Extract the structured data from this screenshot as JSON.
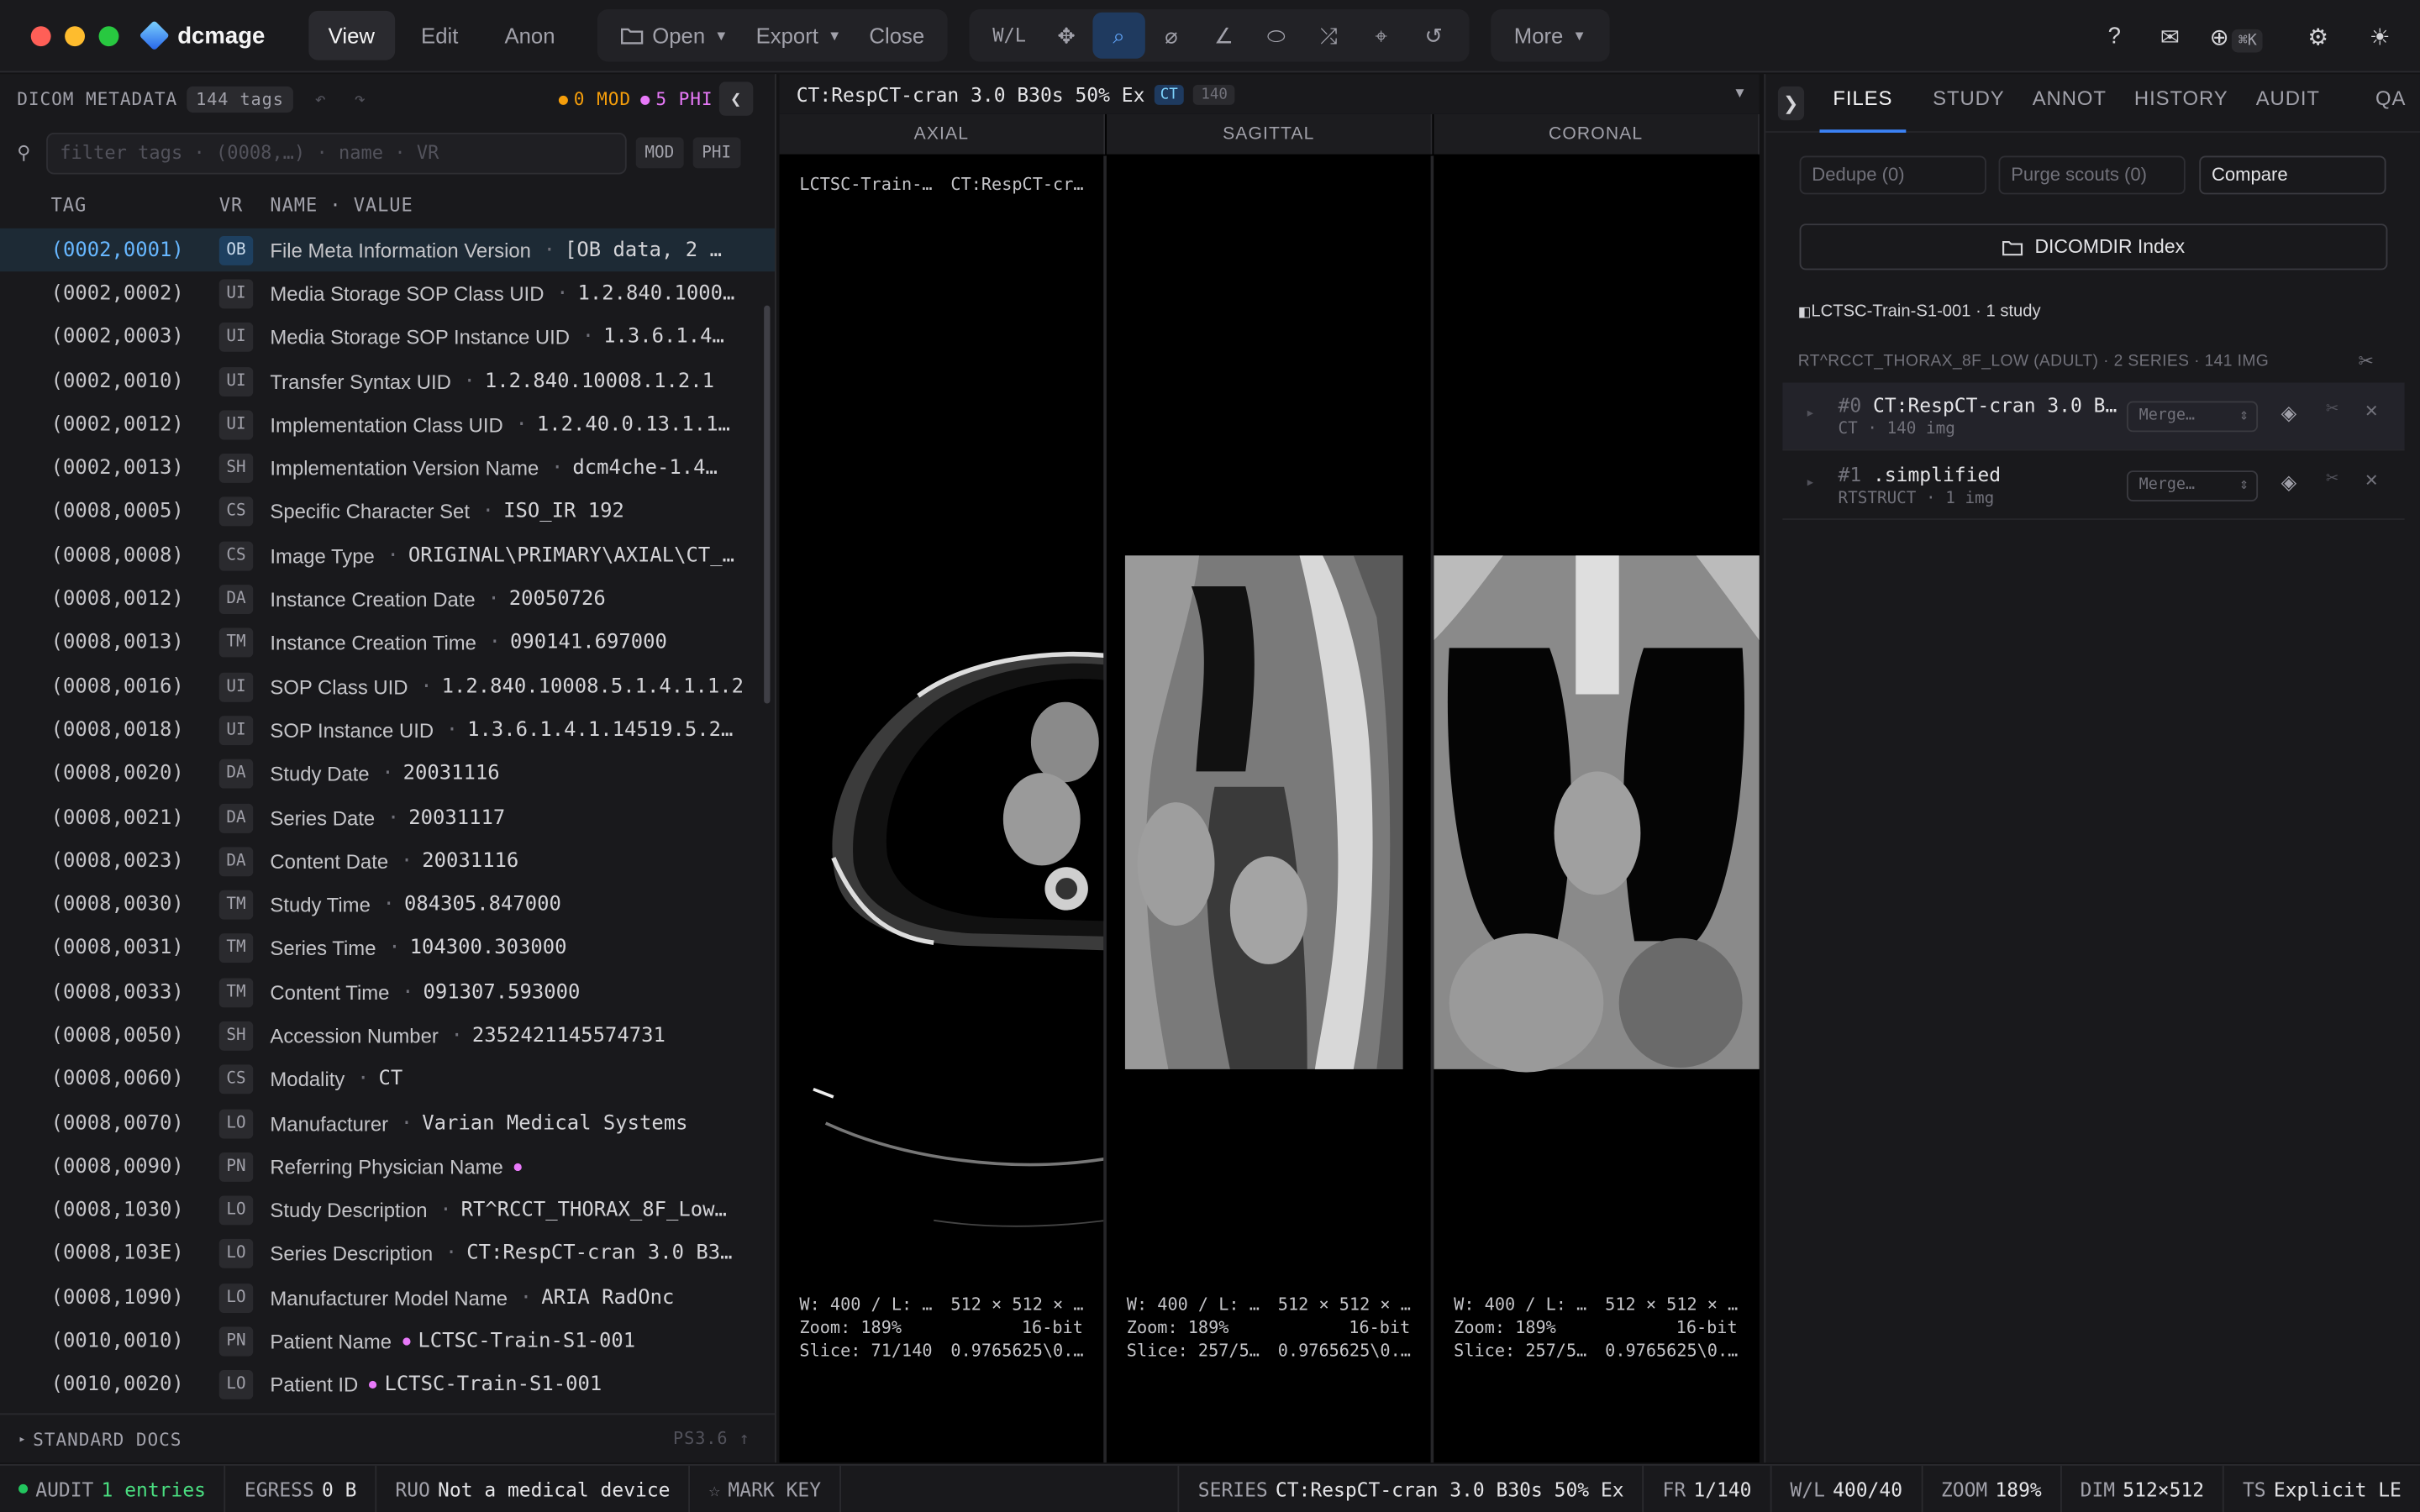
{
  "app": {
    "name": "dcmage"
  },
  "nav": {
    "tabs": [
      "View",
      "Edit",
      "Anon"
    ]
  },
  "file_menu": {
    "open": "Open",
    "export": "Export",
    "close": "Close"
  },
  "tools": {
    "wl": "W/L",
    "more": "More"
  },
  "right_icons": {
    "kbd": "⌘K"
  },
  "metadata": {
    "title": "DICOM METADATA",
    "count": "144 tags",
    "mod": "0 MOD",
    "phi": "5 PHI",
    "filter_placeholder": "filter tags · (0008,…) · name · VR",
    "mod_btn": "MOD",
    "phi_btn": "PHI",
    "col_tag": "TAG",
    "col_vr": "VR",
    "col_name": "NAME · VALUE",
    "rows": [
      {
        "tag": "(0002,0001)",
        "vr": "OB",
        "name": "File Meta Information Version",
        "value": "[OB data, 2 …"
      },
      {
        "tag": "(0002,0002)",
        "vr": "UI",
        "name": "Media Storage SOP Class UID",
        "value": "1.2.840.1000…"
      },
      {
        "tag": "(0002,0003)",
        "vr": "UI",
        "name": "Media Storage SOP Instance UID",
        "value": "1.3.6.1.4…"
      },
      {
        "tag": "(0002,0010)",
        "vr": "UI",
        "name": "Transfer Syntax UID",
        "value": "1.2.840.10008.1.2.1"
      },
      {
        "tag": "(0002,0012)",
        "vr": "UI",
        "name": "Implementation Class UID",
        "value": "1.2.40.0.13.1.1…"
      },
      {
        "tag": "(0002,0013)",
        "vr": "SH",
        "name": "Implementation Version Name",
        "value": "dcm4che-1.4…"
      },
      {
        "tag": "(0008,0005)",
        "vr": "CS",
        "name": "Specific Character Set",
        "value": "ISO_IR 192"
      },
      {
        "tag": "(0008,0008)",
        "vr": "CS",
        "name": "Image Type",
        "value": "ORIGINAL\\PRIMARY\\AXIAL\\CT_…"
      },
      {
        "tag": "(0008,0012)",
        "vr": "DA",
        "name": "Instance Creation Date",
        "value": "20050726"
      },
      {
        "tag": "(0008,0013)",
        "vr": "TM",
        "name": "Instance Creation Time",
        "value": "090141.697000"
      },
      {
        "tag": "(0008,0016)",
        "vr": "UI",
        "name": "SOP Class UID",
        "value": "1.2.840.10008.5.1.4.1.1.2"
      },
      {
        "tag": "(0008,0018)",
        "vr": "UI",
        "name": "SOP Instance UID",
        "value": "1.3.6.1.4.1.14519.5.2…"
      },
      {
        "tag": "(0008,0020)",
        "vr": "DA",
        "name": "Study Date",
        "value": "20031116"
      },
      {
        "tag": "(0008,0021)",
        "vr": "DA",
        "name": "Series Date",
        "value": "20031117"
      },
      {
        "tag": "(0008,0023)",
        "vr": "DA",
        "name": "Content Date",
        "value": "20031116"
      },
      {
        "tag": "(0008,0030)",
        "vr": "TM",
        "name": "Study Time",
        "value": "084305.847000"
      },
      {
        "tag": "(0008,0031)",
        "vr": "TM",
        "name": "Series Time",
        "value": "104300.303000"
      },
      {
        "tag": "(0008,0033)",
        "vr": "TM",
        "name": "Content Time",
        "value": "091307.593000"
      },
      {
        "tag": "(0008,0050)",
        "vr": "SH",
        "name": "Accession Number",
        "value": "2352421145574731"
      },
      {
        "tag": "(0008,0060)",
        "vr": "CS",
        "name": "Modality",
        "value": "CT"
      },
      {
        "tag": "(0008,0070)",
        "vr": "LO",
        "name": "Manufacturer",
        "value": "Varian Medical Systems"
      },
      {
        "tag": "(0008,0090)",
        "vr": "PN",
        "name": "Referring Physician Name",
        "value": "",
        "phi": true
      },
      {
        "tag": "(0008,1030)",
        "vr": "LO",
        "name": "Study Description",
        "value": "RT^RCCT_THORAX_8F_Low…"
      },
      {
        "tag": "(0008,103E)",
        "vr": "LO",
        "name": "Series Description",
        "value": "CT:RespCT-cran 3.0 B3…"
      },
      {
        "tag": "(0008,1090)",
        "vr": "LO",
        "name": "Manufacturer Model Name",
        "value": "ARIA RadOnc"
      },
      {
        "tag": "(0010,0010)",
        "vr": "PN",
        "name": "Patient Name",
        "value": "LCTSC-Train-S1-001",
        "phi": true
      },
      {
        "tag": "(0010,0020)",
        "vr": "LO",
        "name": "Patient ID",
        "value": "LCTSC-Train-S1-001",
        "phi": true
      }
    ],
    "standard_docs": "STANDARD DOCS",
    "ps": "PS3.6"
  },
  "viewer": {
    "series_title": "CT:RespCT-cran 3.0 B30s 50% Ex",
    "modality": "CT",
    "count": "140",
    "views": [
      {
        "name": "AXIAL",
        "tl1": "LCTSC-Train-…",
        "tl2": "CT:RespCT-cr…",
        "wl": "W: 400 / L: …",
        "dims": "512 × 512 × …",
        "zoom": "Zoom: 189%",
        "bit": "16-bit",
        "slice": "Slice: 71/140",
        "spacing": "0.9765625\\0.…"
      },
      {
        "name": "SAGITTAL",
        "wl": "W: 400 / L: …",
        "dims": "512 × 512 × …",
        "zoom": "Zoom: 189%",
        "bit": "16-bit",
        "slice": "Slice: 257/5…",
        "spacing": "0.9765625\\0.…"
      },
      {
        "name": "CORONAL",
        "wl": "W: 400 / L: …",
        "dims": "512 × 512 × …",
        "zoom": "Zoom: 189%",
        "bit": "16-bit",
        "slice": "Slice: 257/5…",
        "spacing": "0.9765625\\0.…"
      }
    ]
  },
  "files": {
    "tabs": [
      "FILES",
      "STUDY",
      "ANNOT",
      "HISTORY",
      "AUDIT",
      "QA"
    ],
    "dedupe": "Dedupe (0)",
    "purge": "Purge scouts (0)",
    "compare": "Compare",
    "dicomdir": "DICOMDIR Index",
    "patient": "LCTSC-Train-S1-001 · 1 study",
    "study": "RT^RCCT_THORAX_8F_LOW (ADULT) · 2 SERIES · 141 IMG",
    "series": [
      {
        "idx": "#0",
        "name": "CT:RespCT-cran 3.0 B…",
        "meta": "CT · 140 img",
        "merge": "Merge…"
      },
      {
        "idx": "#1",
        "name": ".simplified",
        "meta": "RTSTRUCT · 1 img",
        "merge": "Merge…"
      }
    ]
  },
  "status": {
    "audit_label": "AUDIT",
    "audit_val": "1 entries",
    "egress_label": "EGRESS",
    "egress_val": "0 B",
    "ruo_label": "RUO",
    "ruo_val": "Not a medical device",
    "mark": "MARK KEY",
    "series_label": "SERIES",
    "series_val": "CT:RespCT-cran 3.0 B30s 50% Ex",
    "fr_label": "FR",
    "fr_val": "1/140",
    "wl_label": "W/L",
    "wl_val": "400/40",
    "zoom_label": "ZOOM",
    "zoom_val": "189%",
    "dim_label": "DIM",
    "dim_val": "512×512",
    "ts_label": "TS",
    "ts_val": "Explicit LE"
  }
}
